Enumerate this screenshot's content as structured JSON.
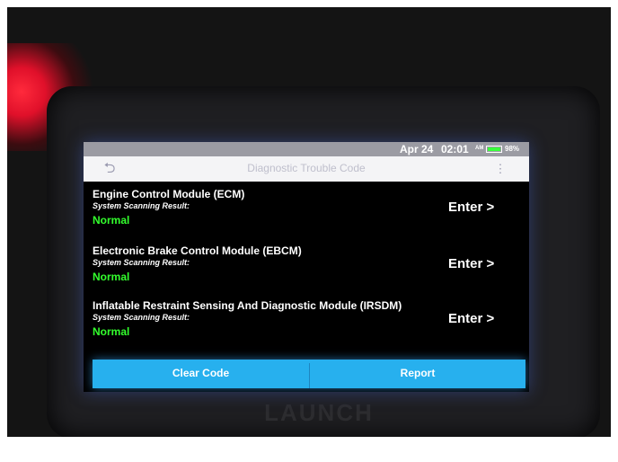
{
  "device": {
    "brand": "LAUNCH"
  },
  "status_bar": {
    "date": "Apr 24",
    "time": "02:01",
    "ampm": "AM",
    "battery_percent": "98%",
    "battery_level": 0.98,
    "battery_color": "#39ff3b"
  },
  "title_bar": {
    "title": "Diagnostic Trouble Code",
    "back_icon": "back-arrow-icon",
    "menu_icon": "menu-icon"
  },
  "modules": [
    {
      "name": "Engine Control Module (ECM)",
      "scan_label": "System Scanning Result:",
      "scan_value": "Normal",
      "action": "Enter >"
    },
    {
      "name": "Electronic Brake Control Module (EBCM)",
      "scan_label": "System Scanning Result:",
      "scan_value": "Normal",
      "action": "Enter >"
    },
    {
      "name": "Inflatable Restraint Sensing And Diagnostic Module (IRSDM)",
      "scan_label": "System Scanning Result:",
      "scan_value": "Normal",
      "action": "Enter >"
    }
  ],
  "bottom_bar": {
    "clear_code": "Clear Code",
    "report": "Report",
    "accent": "#27b0ee"
  },
  "colors": {
    "normal_status": "#33ff2d"
  }
}
